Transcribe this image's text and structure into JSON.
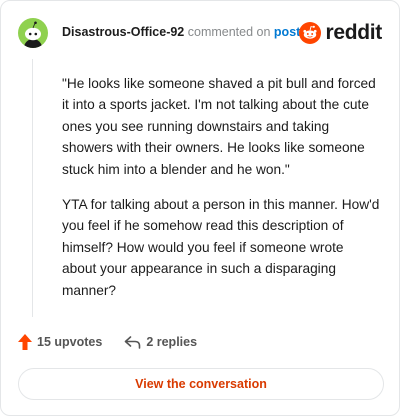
{
  "comment": {
    "username": "Disastrous-Office-92",
    "action_text": "commented on",
    "post_link": "post",
    "brand": "reddit",
    "paragraphs": [
      "\"He looks like someone shaved a pit bull and forced it into a sports jacket. I'm not talking about the cute ones you see running downstairs and taking showers with their owners. He looks like someone stuck him into a blender and he won.\"",
      "YTA for talking about a person in this manner. How'd you feel if he somehow read this description of himself? How would you feel if someone wrote about your appearance in such a disparaging manner?"
    ],
    "upvotes": "15 upvotes",
    "replies": "2 replies",
    "view_button": "View the conversation"
  },
  "colors": {
    "avatar_bg": "#8fd14f",
    "upvote_arrow": "#ff4500",
    "post_link": "#0079d3",
    "view_button_text": "#d93a00",
    "reddit_orange": "#ff4500"
  },
  "icons": [
    "avatar-snoo-icon",
    "reddit-logo-icon",
    "upvote-arrow-icon",
    "reply-arrow-icon"
  ]
}
